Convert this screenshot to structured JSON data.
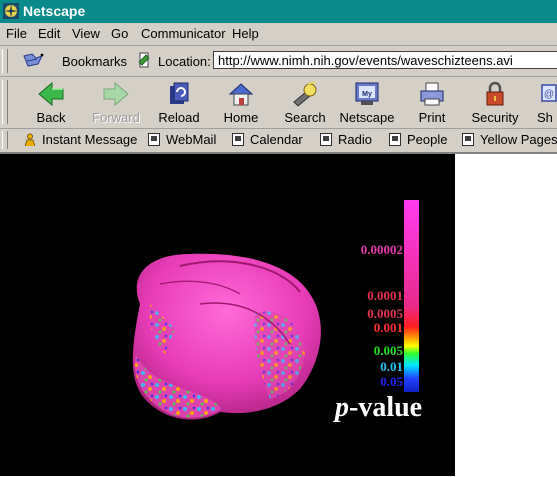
{
  "window": {
    "title": "Netscape"
  },
  "menu": {
    "items": [
      "File",
      "Edit",
      "View",
      "Go",
      "Communicator",
      "Help"
    ]
  },
  "location_bar": {
    "bookmarks_label": "Bookmarks",
    "location_label": "Location:",
    "url": "http://www.nimh.nih.gov/events/waveschizteens.avi"
  },
  "nav_toolbar": {
    "back": "Back",
    "forward": "Forward",
    "reload": "Reload",
    "home": "Home",
    "search": "Search",
    "netscape": "Netscape",
    "print": "Print",
    "security": "Security",
    "shop": "Sh"
  },
  "personal_toolbar": {
    "items": [
      "Instant Message",
      "WebMail",
      "Calendar",
      "Radio",
      "People",
      "Yellow Pages"
    ]
  },
  "content": {
    "colorbar_ticks": [
      {
        "label": "0.00002",
        "color": "#e23aa8"
      },
      {
        "label": "0.0001",
        "color": "#e2304e"
      },
      {
        "label": "0.0005",
        "color": "#e2304e"
      },
      {
        "label": "0.001",
        "color": "#ff3030"
      },
      {
        "label": "0.005",
        "color": "#22dd22"
      },
      {
        "label": "0.01",
        "color": "#22c4ee"
      },
      {
        "label": "0.05",
        "color": "#2222ee"
      }
    ],
    "pvalue_italic": "p",
    "pvalue_rest": "-value",
    "colors": {
      "titlebar": "#0a8a8a",
      "chrome": "#d4d0c8"
    }
  }
}
